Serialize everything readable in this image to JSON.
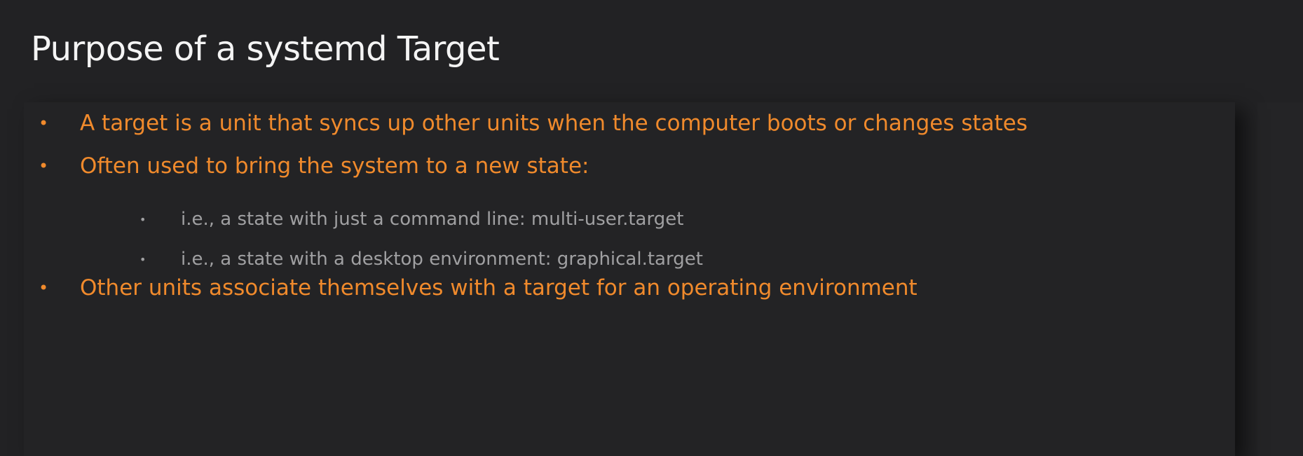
{
  "slide": {
    "title": "Purpose of a systemd Target",
    "bullets": [
      {
        "text": "A target is a unit that syncs up other units when the computer boots or changes states"
      },
      {
        "text": "Often used to bring the system to a new state:"
      },
      {
        "text": "Other units associate themselves with a target for an operating environment"
      }
    ],
    "sub_bullets": [
      {
        "text": "i.e., a state with just a command line:  multi-user.target"
      },
      {
        "text": "i.e., a state with a desktop environment:  graphical.target"
      }
    ],
    "bullet_glyph": "•",
    "colors": {
      "background": "#222224",
      "title": "#f4f4f4",
      "bullet_primary": "#f08a2c",
      "bullet_secondary": "#a0a0a2"
    }
  }
}
